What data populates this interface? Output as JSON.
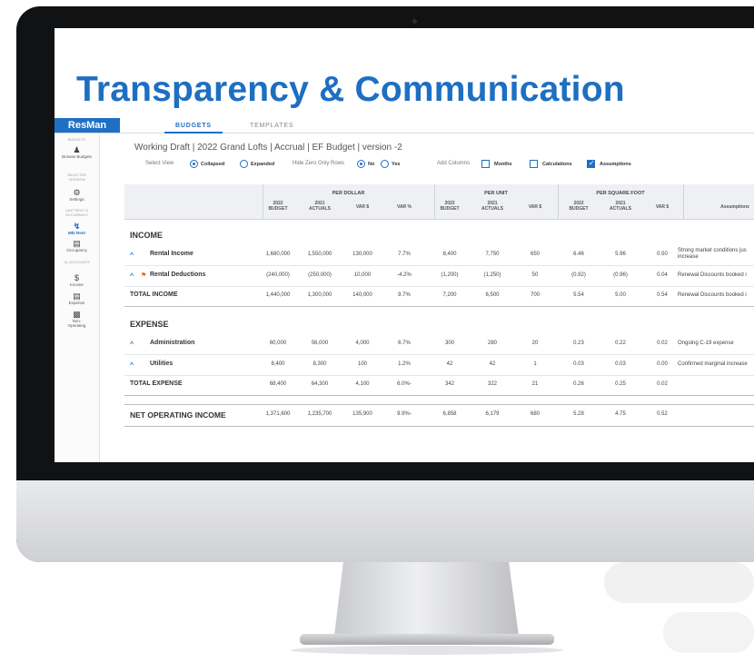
{
  "headline": "Transparency & Communication",
  "app": {
    "logo": "ResMan",
    "tabs": [
      {
        "label": "BUDGETS",
        "active": true
      },
      {
        "label": "TEMPLATES",
        "active": false
      }
    ]
  },
  "sidebar": {
    "sections": [
      "BUDGETS",
      "SELECTED VERSION",
      "UNIT RENT & OCCUPANCY",
      "GL ACCOUNTS"
    ],
    "items": [
      {
        "label": "Browse Budgets",
        "icon": "person-icon"
      },
      {
        "label": "Settings",
        "icon": "gear-icon"
      },
      {
        "label": "Mkt Rent",
        "icon": "rent-icon",
        "active": true
      },
      {
        "label": "Occupancy",
        "icon": "building-icon"
      },
      {
        "label": "Income",
        "icon": "dollar-icon"
      },
      {
        "label": "Expense",
        "icon": "receipt-icon"
      },
      {
        "label": "Non-Operating",
        "icon": "document-icon"
      }
    ]
  },
  "doc_title": "Working Draft | 2022 Grand Lofts | Accrual | EF Budget | version -2",
  "options": {
    "select_view_label": "Select View",
    "collapsed": "Collapsed",
    "expanded": "Expanded",
    "selected_view": "Collapsed",
    "hide_zero_label": "Hide Zero Only Rows",
    "no": "No",
    "yes": "Yes",
    "hide_zero_value": "No",
    "add_columns_label": "Add Columns",
    "months": "Months",
    "calculations": "Calculations",
    "assumptions": "Assumptions",
    "assumptions_checked": true
  },
  "table": {
    "groups": [
      "PER DOLLAR",
      "PER UNIT",
      "PER SQUARE FOOT"
    ],
    "subheaders": {
      "budget": [
        "2022",
        "BUDGET"
      ],
      "actuals": [
        "2021",
        "ACTUALS"
      ],
      "var_dollar": "VAR $",
      "var_pct": "VAR %",
      "assumptions": "Assumptions"
    },
    "sections": [
      {
        "title": "INCOME",
        "rows": [
          {
            "label": "Rental Income",
            "flag": false,
            "values": [
              "1,680,000",
              "1,550,000",
              "130,000",
              "7.7%",
              "8,400",
              "7,750",
              "650",
              "6.46",
              "5.96",
              "0.50"
            ],
            "assumption": [
              "Strong market conditions jus",
              "increase"
            ]
          },
          {
            "label": "Rental Deductions",
            "flag": true,
            "values": [
              "(240,000)",
              "(250,000)",
              "10,000",
              "-4.2%",
              "(1,200)",
              "(1,250)",
              "50",
              "(0.92)",
              "(0.96)",
              "0.04"
            ],
            "assumption": [
              "Renewal Discounts booked i"
            ]
          }
        ],
        "total": {
          "label": "TOTAL INCOME",
          "values": [
            "1,440,000",
            "1,300,000",
            "140,000",
            "9.7%",
            "7,200",
            "6,500",
            "700",
            "5.54",
            "5.00",
            "0.54"
          ],
          "assumption": "Renewal Discounts booked i"
        }
      },
      {
        "title": "EXPENSE",
        "rows": [
          {
            "label": "Administration",
            "flag": false,
            "values": [
              "60,000",
              "56,000",
              "4,000",
              "6.7%",
              "300",
              "280",
              "20",
              "0.23",
              "0.22",
              "0.02"
            ],
            "assumption": [
              "Ongoing C-19 expense"
            ]
          },
          {
            "label": "Utilities",
            "flag": false,
            "values": [
              "8,400",
              "8,300",
              "100",
              "1.2%",
              "42",
              "42",
              "1",
              "0.03",
              "0.03",
              "0.00"
            ],
            "assumption": [
              "Confirmed marginal increase"
            ]
          }
        ],
        "total": {
          "label": "TOTAL EXPENSE",
          "values": [
            "68,400",
            "64,300",
            "4,100",
            "6.0%-",
            "342",
            "322",
            "21",
            "0.26",
            "0.25",
            "0.02"
          ],
          "assumption": ""
        }
      }
    ],
    "noi": {
      "label": "NET OPERATING INCOME",
      "values": [
        "1,371,600",
        "1,235,700",
        "135,900",
        "9.9%-",
        "6,858",
        "6,179",
        "680",
        "5.28",
        "4.75",
        "0.52"
      ]
    }
  },
  "colors": {
    "brand": "#1f6fc4",
    "headline": "#1d6fc2",
    "flag": "#e0601a",
    "bezel": "#111214"
  }
}
